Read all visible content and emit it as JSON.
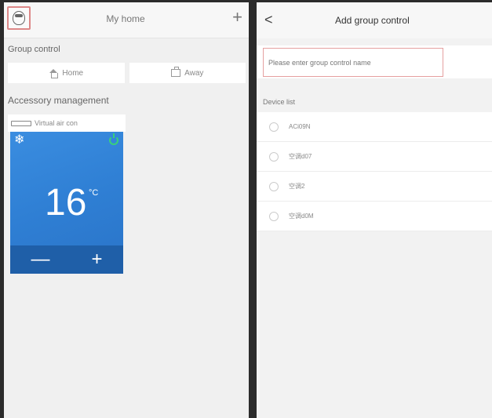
{
  "left": {
    "header": {
      "title": "My home",
      "add_label": "+"
    },
    "group_control": {
      "label": "Group control",
      "buttons": [
        {
          "label": "Home",
          "icon": "home-icon"
        },
        {
          "label": "Away",
          "icon": "away-icon"
        }
      ]
    },
    "accessory": {
      "label": "Accessory management",
      "tab_label": "Virtual air con"
    },
    "ac_card": {
      "mode_icon": "snowflake-icon",
      "temperature": "16",
      "unit": "°C",
      "minus_label": "—",
      "plus_label": "+",
      "colors": {
        "card": "#2f7fd4",
        "power": "#3ad07a"
      }
    }
  },
  "right": {
    "header": {
      "back_label": "<",
      "title": "Add group control"
    },
    "name_input": {
      "placeholder": "Please enter group control name",
      "value": ""
    },
    "device_list": {
      "label": "Device list",
      "items": [
        "ACi09N",
        "空调d07",
        "空调2",
        "空调d0M"
      ]
    }
  }
}
